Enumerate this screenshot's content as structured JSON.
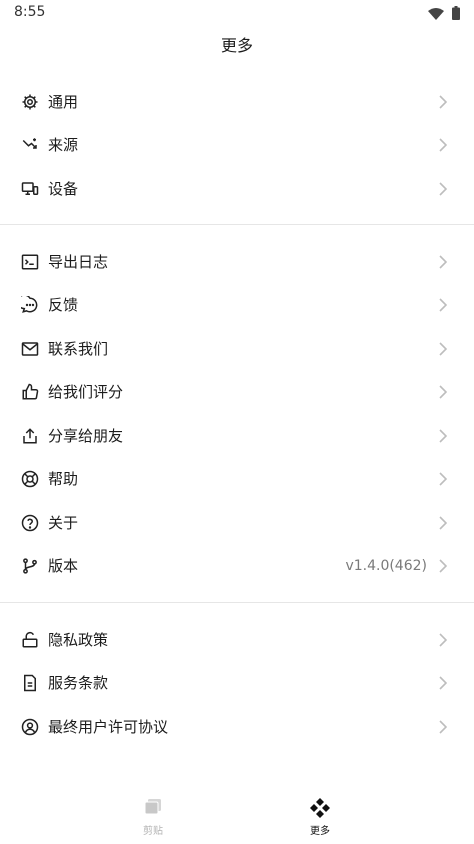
{
  "status": {
    "time": "8:55"
  },
  "header": {
    "title": "更多"
  },
  "sections": [
    {
      "items": [
        {
          "id": "general",
          "label": "通用",
          "icon": "gear-icon"
        },
        {
          "id": "sources",
          "label": "来源",
          "icon": "source-icon"
        },
        {
          "id": "devices",
          "label": "设备",
          "icon": "devices-icon"
        }
      ]
    },
    {
      "items": [
        {
          "id": "export-logs",
          "label": "导出日志",
          "icon": "terminal-icon"
        },
        {
          "id": "feedback",
          "label": "反馈",
          "icon": "chat-bubble-icon"
        },
        {
          "id": "contact",
          "label": "联系我们",
          "icon": "mail-icon"
        },
        {
          "id": "rate",
          "label": "给我们评分",
          "icon": "thumbs-up-icon"
        },
        {
          "id": "share",
          "label": "分享给朋友",
          "icon": "share-icon"
        },
        {
          "id": "help",
          "label": "帮助",
          "icon": "lifebuoy-icon"
        },
        {
          "id": "about",
          "label": "关于",
          "icon": "question-circle-icon"
        },
        {
          "id": "version",
          "label": "版本",
          "icon": "git-branch-icon",
          "value": "v1.4.0(462)"
        }
      ]
    },
    {
      "items": [
        {
          "id": "privacy",
          "label": "隐私政策",
          "icon": "unlock-icon"
        },
        {
          "id": "terms",
          "label": "服务条款",
          "icon": "document-icon"
        },
        {
          "id": "eula",
          "label": "最终用户许可协议",
          "icon": "user-circle-icon"
        }
      ]
    }
  ],
  "tabs": [
    {
      "id": "clipboard",
      "label": "剪贴",
      "icon": "clipboard-stack-icon",
      "active": false
    },
    {
      "id": "more",
      "label": "更多",
      "icon": "diamond-grid-icon",
      "active": true
    }
  ],
  "colors": {
    "text": "#1c1c1c",
    "muted": "#7a7a7a",
    "chevron": "#bdbdbd",
    "divider": "#e6e6e6"
  }
}
